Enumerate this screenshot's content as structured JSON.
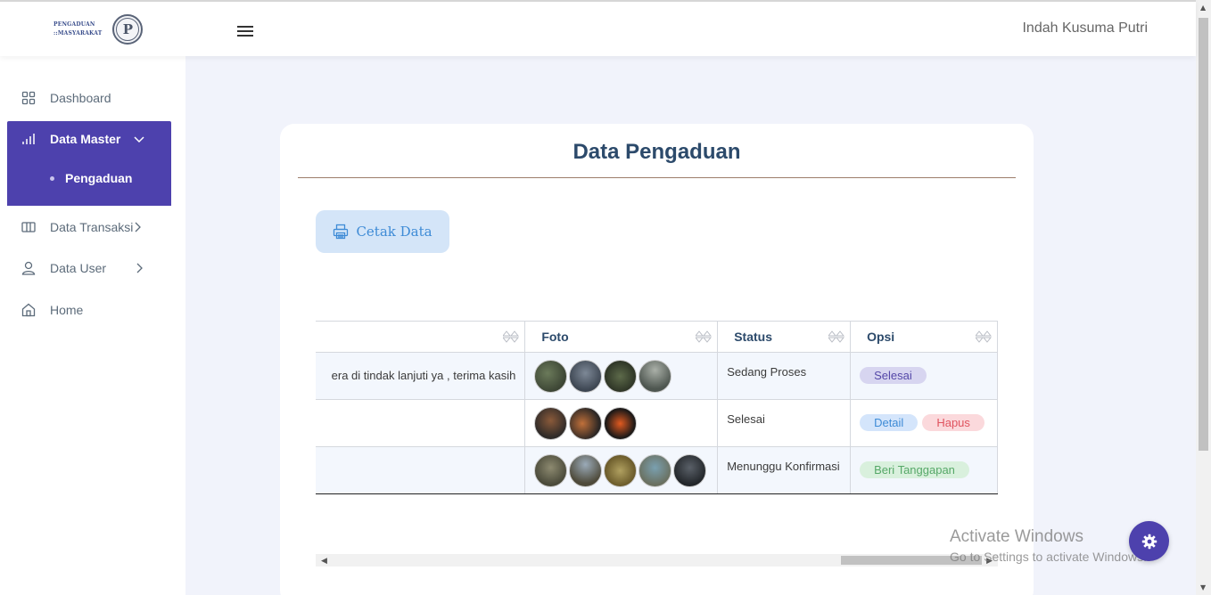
{
  "header": {
    "logo_line1": "PENGADUAN",
    "logo_line2": "::MASYARAKAT",
    "logo_letter": "P",
    "menu_icon": "hamburger-icon",
    "user_name": "Indah Kusuma Putri"
  },
  "sidebar": {
    "items": [
      {
        "label": "Dashboard",
        "icon": "grid-icon"
      },
      {
        "label": "Data Master",
        "icon": "bar-chart-icon"
      },
      {
        "label": "Data Transaksi",
        "icon": "columns-icon"
      },
      {
        "label": "Data User",
        "icon": "user-icon"
      },
      {
        "label": "Home",
        "icon": "home-icon"
      }
    ],
    "sub_items": [
      {
        "label": "Pengaduan"
      }
    ]
  },
  "main": {
    "title": "Data Pengaduan",
    "print_button": "Cetak Data",
    "table": {
      "columns": [
        "",
        "Foto",
        "Status",
        "Opsi"
      ],
      "rows": [
        {
          "isi": "era di tindak lanjuti ya , terima kasih",
          "photo_count": 4,
          "status": "Sedang Proses",
          "actions": [
            "Selesai"
          ]
        },
        {
          "isi": "",
          "photo_count": 3,
          "status": "Selesai",
          "actions": [
            "Detail",
            "Hapus"
          ]
        },
        {
          "isi": "",
          "photo_count": 5,
          "status": "Menunggu Konfirmasi",
          "actions": [
            "Beri Tanggapan"
          ]
        }
      ]
    }
  },
  "watermark": {
    "line1": "Activate Windows",
    "line2": "Go to Settings to activate Windows."
  },
  "colors": {
    "primary": "#4d41ad",
    "title": "#2c4a6b",
    "badge_purple": "#d7d5f0",
    "badge_blue": "#d4e5fb",
    "badge_red": "#fbd9dc",
    "badge_green": "#d9f0dd"
  }
}
